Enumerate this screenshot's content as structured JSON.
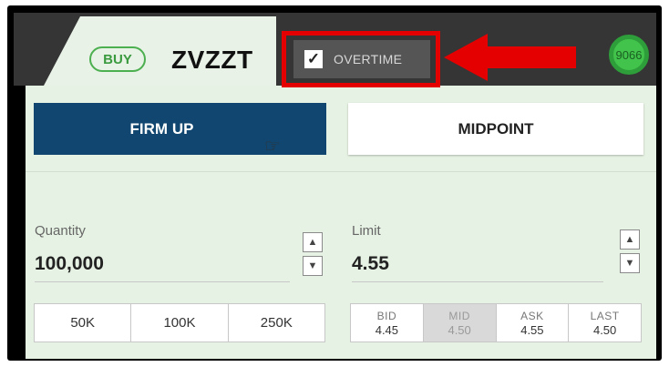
{
  "order": {
    "side_label": "BUY",
    "symbol": "ZVZZT",
    "badge_number": "9066"
  },
  "overtime": {
    "checked": true,
    "check_glyph": "✓",
    "label": "OVERTIME"
  },
  "actions": {
    "firm_up_label": "FIRM UP",
    "midpoint_label": "MIDPOINT"
  },
  "quantity": {
    "label": "Quantity",
    "value": "100,000",
    "presets": [
      "50K",
      "100K",
      "250K"
    ]
  },
  "limit": {
    "label": "Limit",
    "value": "4.55",
    "prices": [
      {
        "label": "BID",
        "value": "4.45"
      },
      {
        "label": "MID",
        "value": "4.50"
      },
      {
        "label": "ASK",
        "value": "4.55"
      },
      {
        "label": "LAST",
        "value": "4.50"
      }
    ]
  },
  "glyphs": {
    "up": "▲",
    "down": "▼",
    "cursor": "☞"
  },
  "colors": {
    "accent_buy": "#4caf50",
    "firm_up_bg": "#10466f",
    "panel_bg": "#e6f2e3",
    "annotation_red": "#e40000"
  }
}
